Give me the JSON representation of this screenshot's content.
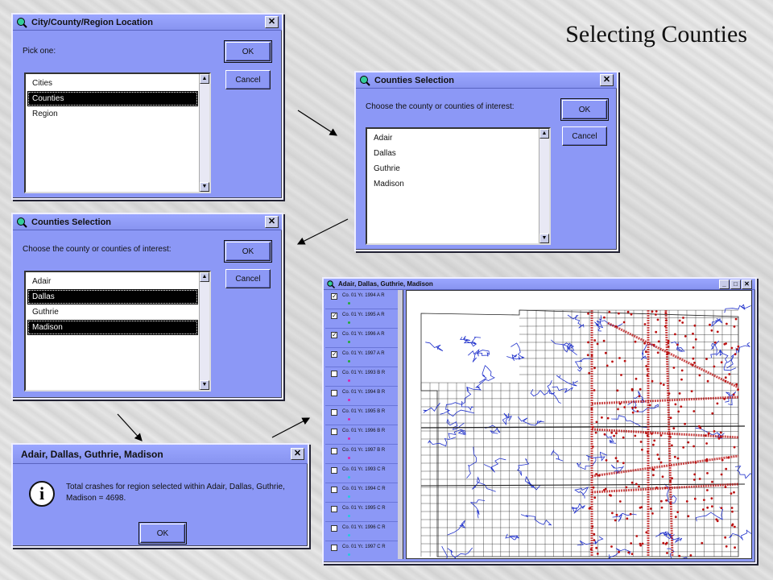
{
  "slide": {
    "title": "Selecting Counties"
  },
  "dialog_location": {
    "title": "City/County/Region Location",
    "prompt": "Pick one:",
    "ok": "OK",
    "cancel": "Cancel",
    "options": [
      "Cities",
      "Counties",
      "Region"
    ],
    "selected": "Counties"
  },
  "dialog_counties_empty": {
    "title": "Counties Selection",
    "prompt": "Choose the county or counties of interest:",
    "ok": "OK",
    "cancel": "Cancel",
    "options": [
      "Adair",
      "Dallas",
      "Guthrie",
      "Madison"
    ]
  },
  "dialog_counties_selected": {
    "title": "Counties Selection",
    "prompt": "Choose the county or counties of interest:",
    "ok": "OK",
    "cancel": "Cancel",
    "options": [
      "Adair",
      "Dallas",
      "Guthrie",
      "Madison"
    ],
    "selected": [
      "Dallas",
      "Madison"
    ]
  },
  "dialog_message": {
    "title": "Adair, Dallas, Guthrie, Madison",
    "message_line1": "Total crashes for region selected within Adair, Dallas, Guthrie,",
    "message_line2": "Madison = 4698.",
    "ok": "OK",
    "icon": "info-icon"
  },
  "map_window": {
    "title": "Adair, Dallas, Guthrie, Madison",
    "legend": [
      {
        "label": "Co. 01 Yr. 1994 A R",
        "checked": true,
        "color": "#22aa33"
      },
      {
        "label": "Co. 01 Yr. 1995 A R",
        "checked": true,
        "color": "#22aa33"
      },
      {
        "label": "Co. 01 Yr. 1996 A R",
        "checked": true,
        "color": "#22aa33"
      },
      {
        "label": "Co. 01 Yr. 1997 A R",
        "checked": true,
        "color": "#22aa33"
      },
      {
        "label": "Co. 01 Yr. 1993 B R",
        "checked": false,
        "color": "#dd22aa"
      },
      {
        "label": "Co. 01 Yr. 1994 B R",
        "checked": false,
        "color": "#dd22aa"
      },
      {
        "label": "Co. 01 Yr. 1995 B R",
        "checked": false,
        "color": "#dd22aa"
      },
      {
        "label": "Co. 01 Yr. 1996 B R",
        "checked": false,
        "color": "#dd22aa"
      },
      {
        "label": "Co. 01 Yr. 1997 B R",
        "checked": false,
        "color": "#dd22aa"
      },
      {
        "label": "Co. 01 Yr. 1993 C R",
        "checked": false,
        "color": "#22ccdd"
      },
      {
        "label": "Co. 01 Yr. 1994 C R",
        "checked": false,
        "color": "#22ccdd"
      },
      {
        "label": "Co. 01 Yr. 1995 C R",
        "checked": false,
        "color": "#22ccdd"
      },
      {
        "label": "Co. 01 Yr. 1996 C R",
        "checked": false,
        "color": "#22ccdd"
      },
      {
        "label": "Co. 01 Yr. 1997 C R",
        "checked": false,
        "color": "#22ccdd"
      }
    ],
    "colors": {
      "roads": "#222222",
      "rivers": "#2233cc",
      "crashes": "#bb1111"
    }
  }
}
